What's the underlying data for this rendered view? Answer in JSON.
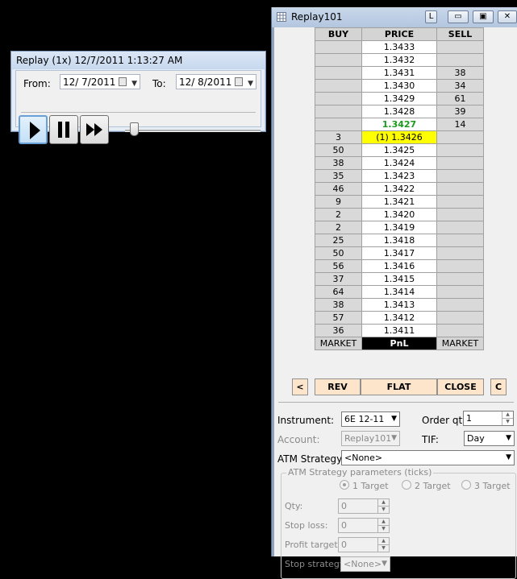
{
  "replay_window": {
    "title": "Replay (1x) 12/7/2011 1:13:27 AM",
    "from_label": "From:",
    "from_date": "12/  7/2011",
    "to_label": "To:",
    "to_date": "12/  8/2011",
    "playback_speed_position": 0.05
  },
  "dom_window": {
    "title": "Replay101",
    "title_buttons": [
      "L"
    ],
    "ladder": {
      "headers": [
        "BUY",
        "PRICE",
        "SELL"
      ],
      "rows": [
        {
          "buy": "",
          "price": "1.3433",
          "sell": ""
        },
        {
          "buy": "",
          "price": "1.3432",
          "sell": ""
        },
        {
          "buy": "",
          "price": "1.3431",
          "sell": "38"
        },
        {
          "buy": "",
          "price": "1.3430",
          "sell": "34"
        },
        {
          "buy": "",
          "price": "1.3429",
          "sell": "61"
        },
        {
          "buy": "",
          "price": "1.3428",
          "sell": "39"
        },
        {
          "buy": "",
          "price": "1.3427",
          "sell": "14"
        },
        {
          "buy": "3",
          "price": "(1) 1.3426",
          "sell": ""
        },
        {
          "buy": "50",
          "price": "1.3425",
          "sell": ""
        },
        {
          "buy": "38",
          "price": "1.3424",
          "sell": ""
        },
        {
          "buy": "35",
          "price": "1.3423",
          "sell": ""
        },
        {
          "buy": "46",
          "price": "1.3422",
          "sell": ""
        },
        {
          "buy": "9",
          "price": "1.3421",
          "sell": ""
        },
        {
          "buy": "2",
          "price": "1.3420",
          "sell": ""
        },
        {
          "buy": "2",
          "price": "1.3419",
          "sell": ""
        },
        {
          "buy": "25",
          "price": "1.3418",
          "sell": ""
        },
        {
          "buy": "50",
          "price": "1.3417",
          "sell": ""
        },
        {
          "buy": "56",
          "price": "1.3416",
          "sell": ""
        },
        {
          "buy": "37",
          "price": "1.3415",
          "sell": ""
        },
        {
          "buy": "64",
          "price": "1.3414",
          "sell": ""
        },
        {
          "buy": "38",
          "price": "1.3413",
          "sell": ""
        },
        {
          "buy": "57",
          "price": "1.3412",
          "sell": ""
        },
        {
          "buy": "36",
          "price": "1.3411",
          "sell": ""
        }
      ],
      "last_price_row": 6,
      "position_row": 7,
      "footer": {
        "buy": "MARKET",
        "price": "PnL",
        "sell": "MARKET"
      }
    },
    "order_buttons": {
      "left": "<",
      "rev": "REV",
      "flat": "FLAT",
      "close": "CLOSE",
      "c": "C"
    },
    "form": {
      "instrument_label": "Instrument:",
      "instrument_value": "6E 12-11",
      "order_qty_label": "Order qty:",
      "order_qty_value": "1",
      "account_label": "Account:",
      "account_value": "Replay101",
      "tif_label": "TIF:",
      "tif_value": "Day",
      "atm_label": "ATM Strategy:",
      "atm_value": "<None>",
      "atm_params_legend": "ATM Strategy parameters (ticks)",
      "targets": [
        "1 Target",
        "2 Target",
        "3 Target"
      ],
      "selected_target": 0,
      "qty_label": "Qty:",
      "qty_value": "0",
      "stop_loss_label": "Stop loss:",
      "stop_loss_value": "0",
      "profit_target_label": "Profit target:",
      "profit_target_value": "0",
      "stop_strategy_label": "Stop strategy:",
      "stop_strategy_value": "<None>"
    },
    "colors": {
      "position_highlight": "#ffff00",
      "last_price": "#1a9a1a",
      "order_buttons": "#fde5cc"
    }
  }
}
